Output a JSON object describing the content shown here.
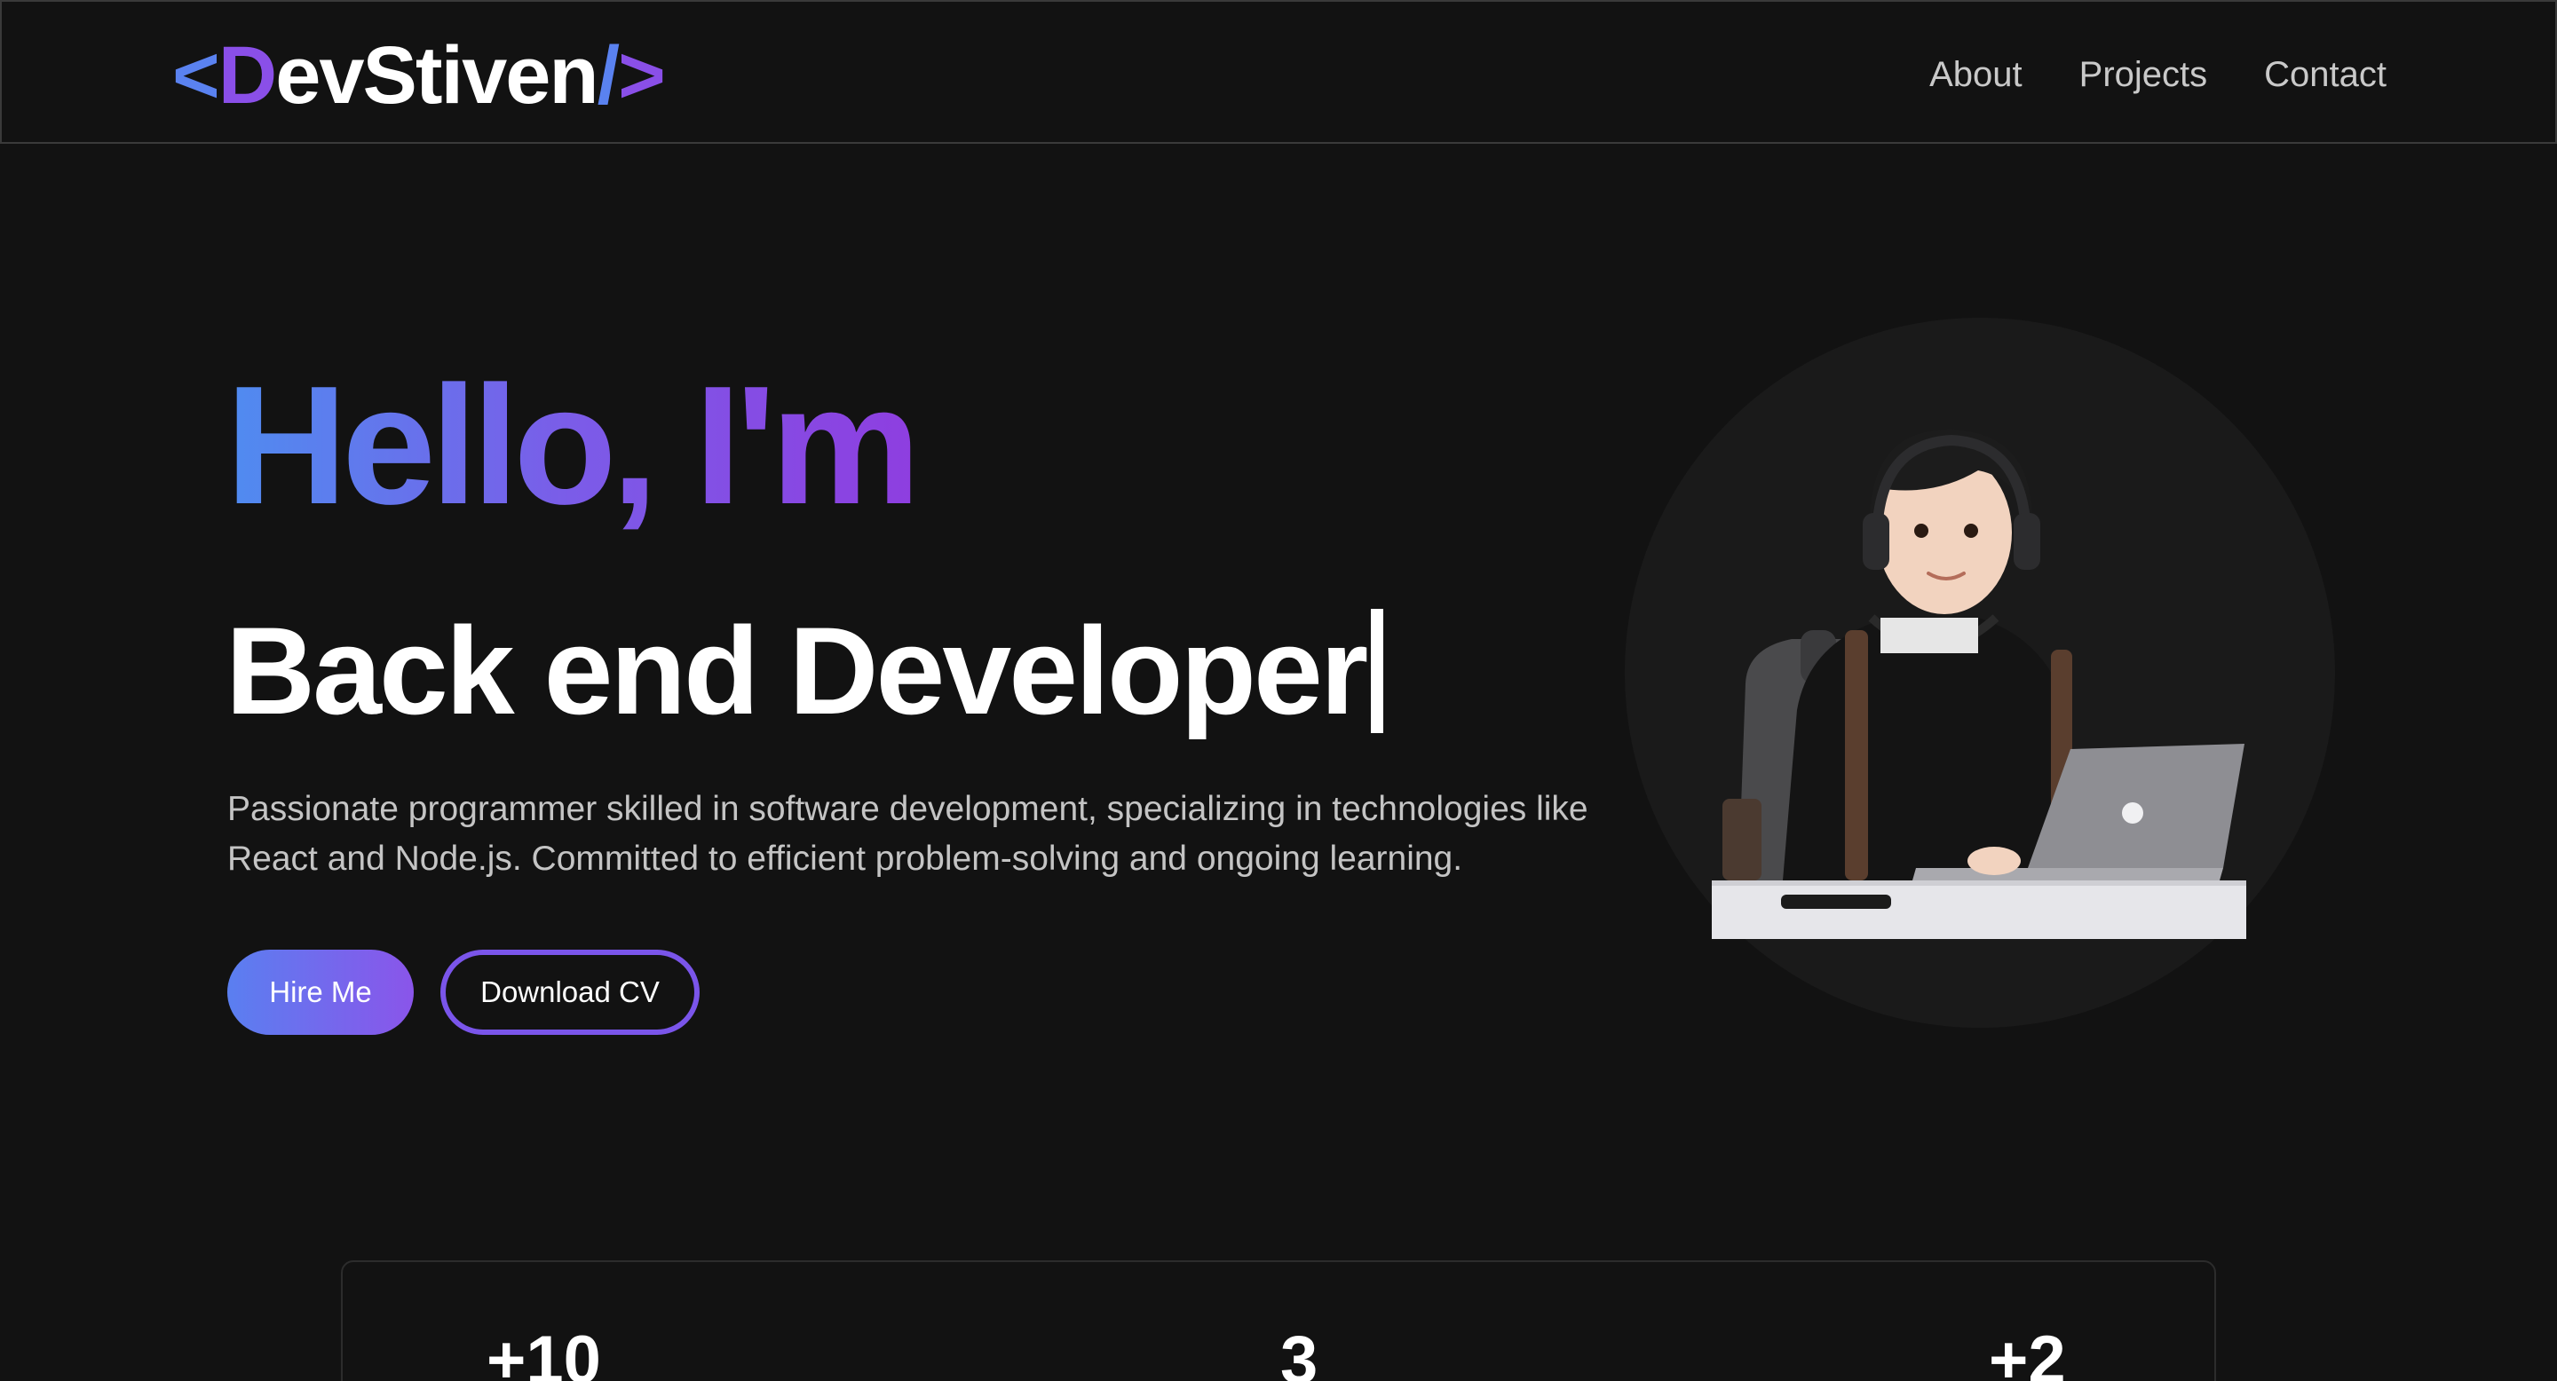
{
  "header": {
    "logo": {
      "bracket_open": "<",
      "accent_letter": "D",
      "name_rest": "evStiven",
      "slash": "/",
      "bracket_close": ">"
    },
    "nav": [
      {
        "label": "About"
      },
      {
        "label": "Projects"
      },
      {
        "label": "Contact"
      }
    ]
  },
  "hero": {
    "greeting": "Hello, I'm",
    "role": "Back end Developer",
    "description": "Passionate programmer skilled in software development, specializing in technologies like React and Node.js. Committed to efficient problem-solving and ongoing learning.",
    "hire_button": "Hire Me",
    "cv_button": "Download CV"
  },
  "stats": [
    {
      "value": "+10"
    },
    {
      "value": "3"
    },
    {
      "value": "+2"
    }
  ],
  "colors": {
    "background": "#121212",
    "gradient_start": "#4f8cf0",
    "gradient_end": "#8e3ee0",
    "text_muted": "#c4c4c4"
  }
}
